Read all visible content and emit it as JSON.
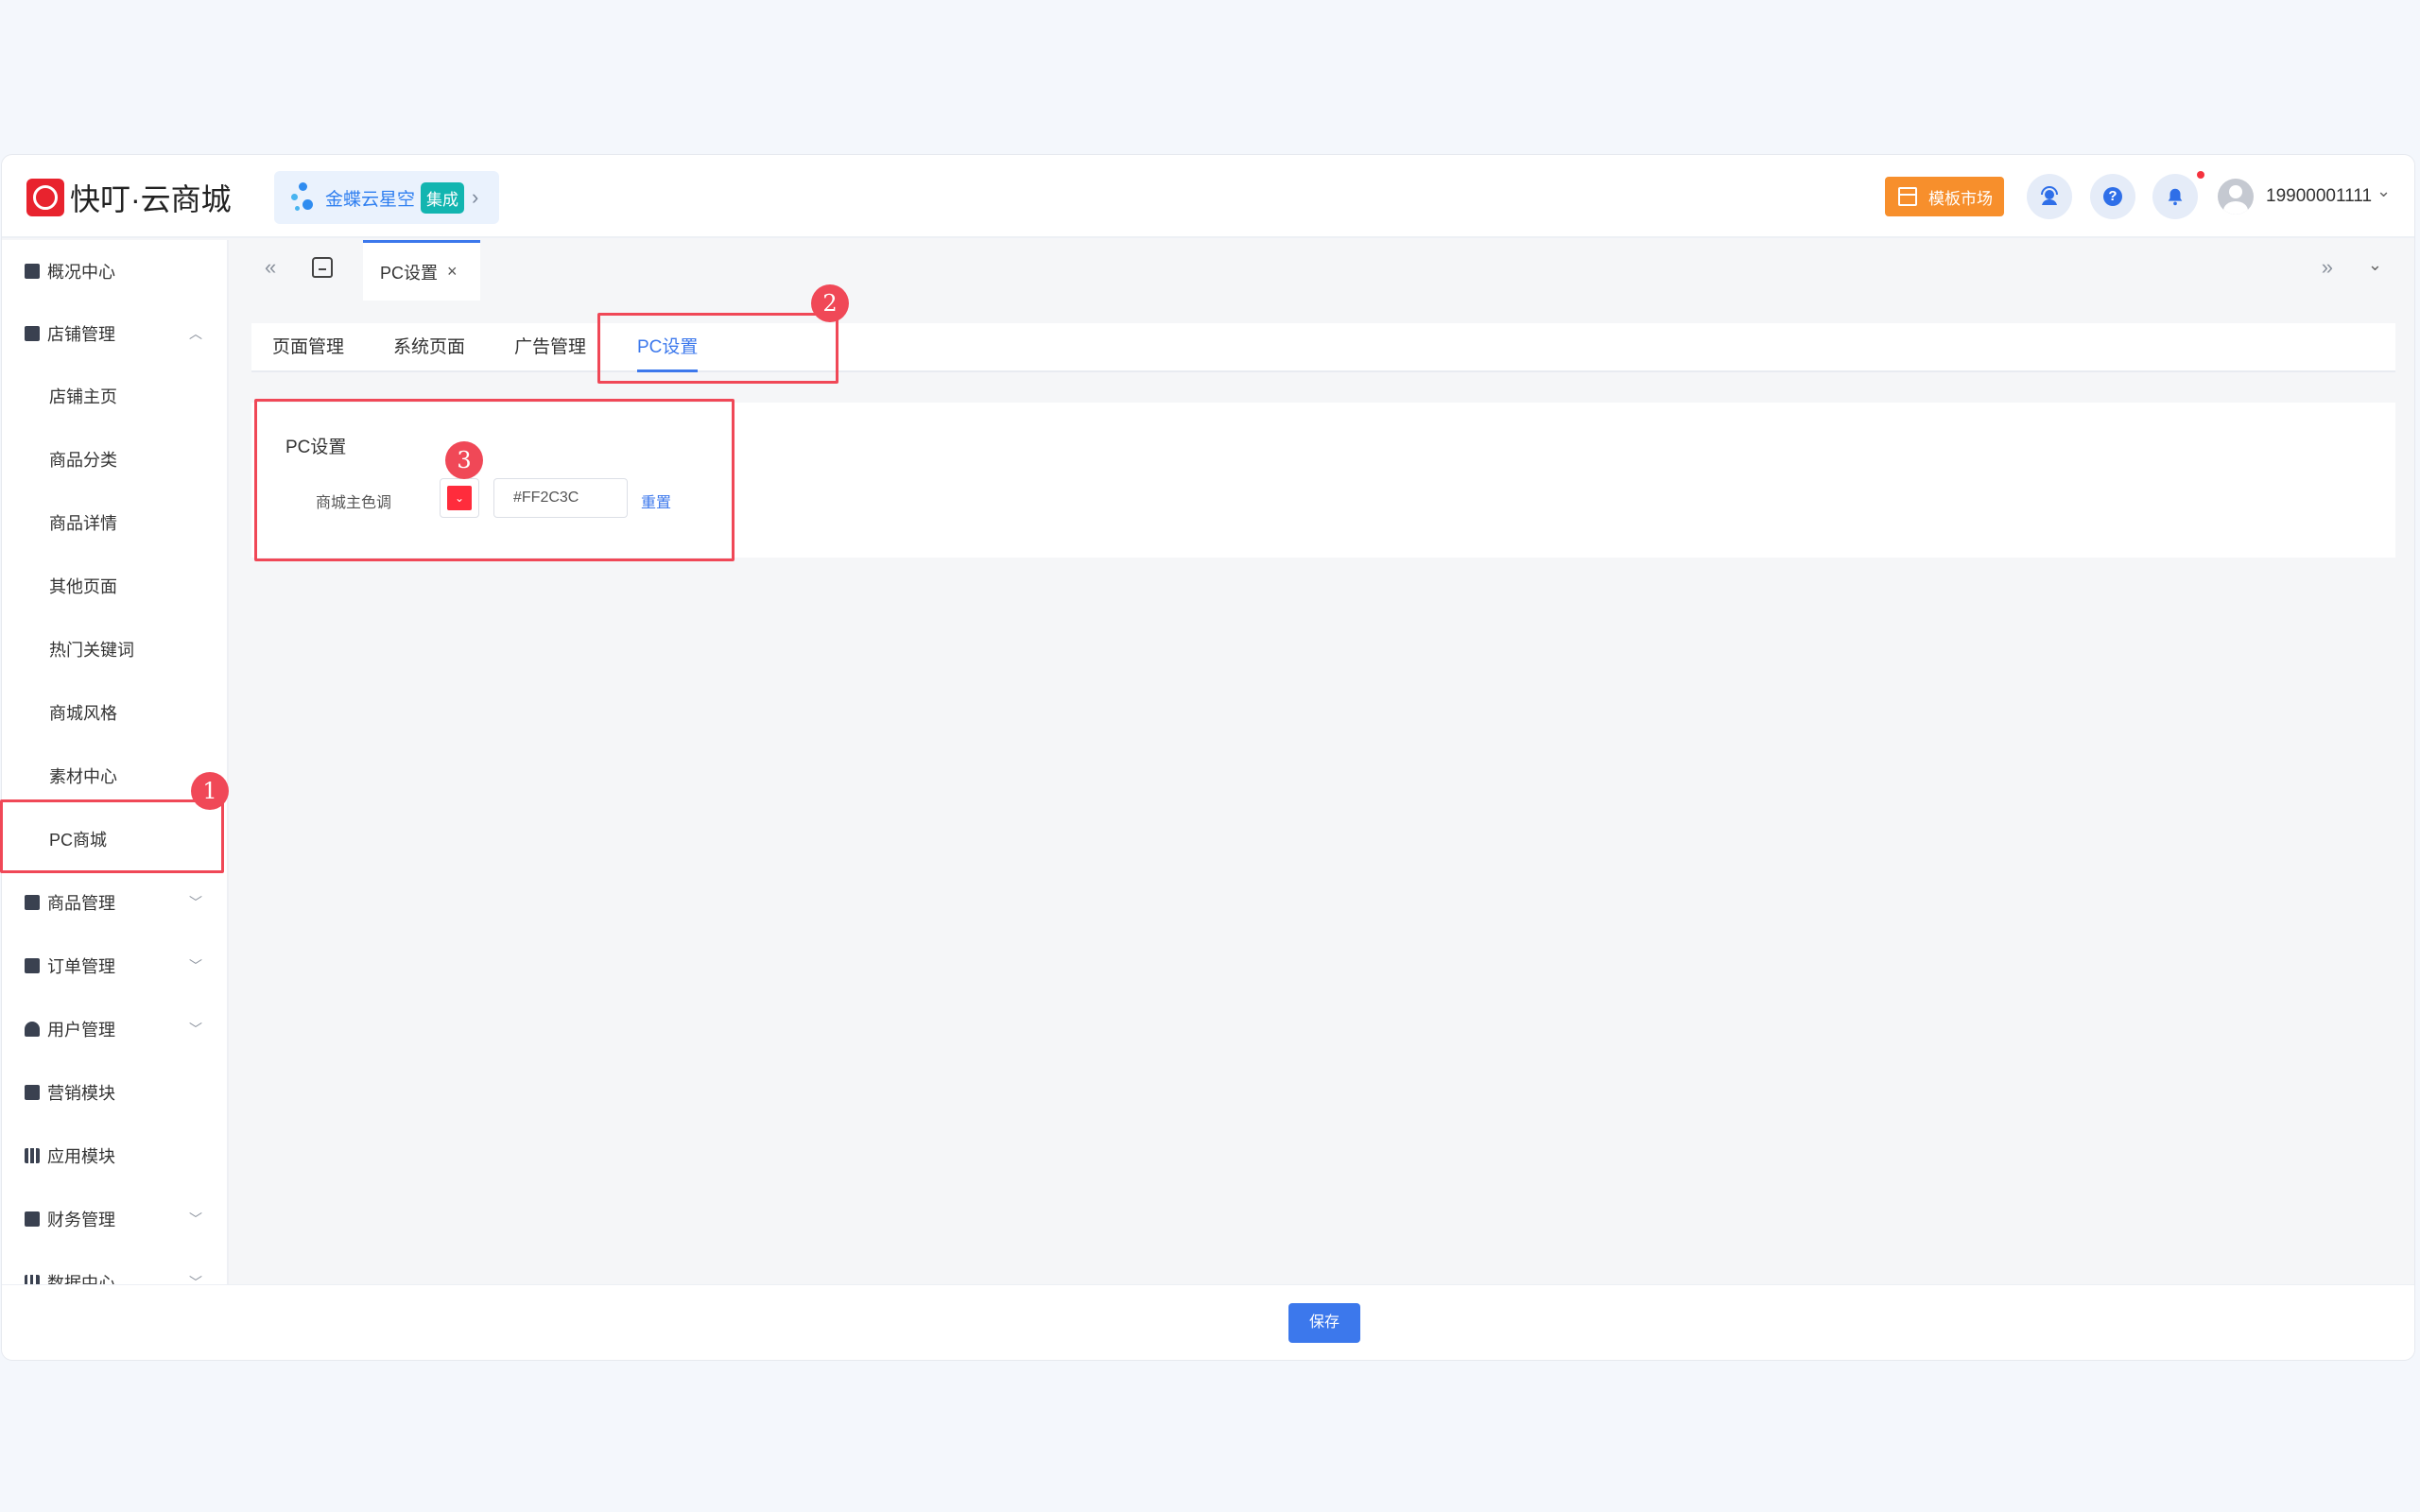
{
  "brand": {
    "name": "快叮·云商城"
  },
  "integration": {
    "name": "金蝶云星空",
    "tag": "集成",
    "arrow": "›"
  },
  "header": {
    "template_market": "模板市场",
    "help": "?",
    "user": "19900001111",
    "user_caret": "⌄"
  },
  "sidebar": {
    "overview": "概况中心",
    "store": "店铺管理",
    "store_sub": [
      "店铺主页",
      "商品分类",
      "商品详情",
      "其他页面",
      "热门关键词",
      "商城风格",
      "素材中心",
      "PC商城"
    ],
    "goods": "商品管理",
    "orders": "订单管理",
    "users": "用户管理",
    "marketing": "营销模块",
    "apps": "应用模块",
    "finance": "财务管理",
    "data": "数据中心"
  },
  "tabbar": {
    "left_arrows": "«",
    "right_arrows": "»",
    "active_tab": "PC设置",
    "close": "×",
    "dropdown": "⌄"
  },
  "subtabs": [
    "页面管理",
    "系统页面",
    "广告管理",
    "PC设置"
  ],
  "panel": {
    "title": "PC设置",
    "label": "商城主色调",
    "color_value": "#FF2C3C",
    "reset": "重置"
  },
  "footer": {
    "save": "保存"
  },
  "annotations": [
    "1",
    "2",
    "3"
  ],
  "colors": {
    "primary": "#3c78ec",
    "theme_swatch": "#ff2c3c",
    "highlight": "#f04857",
    "market_btn": "#f78f2c"
  }
}
